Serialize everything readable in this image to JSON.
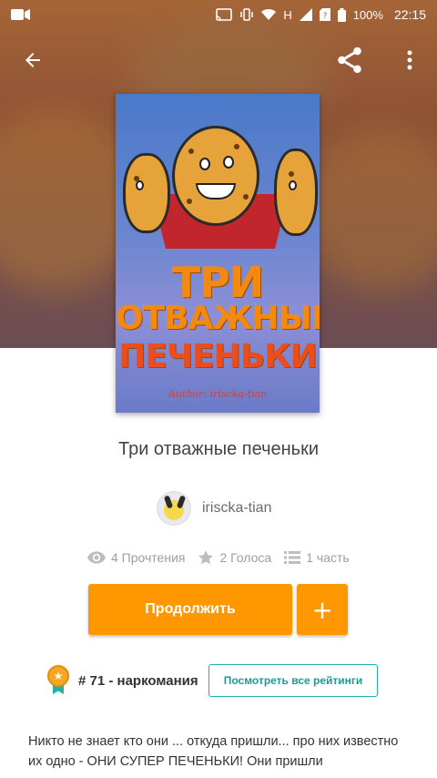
{
  "status_bar": {
    "battery": "100%",
    "time": "22:15",
    "network": "H"
  },
  "toolbar": {
    "back_icon": "arrow-left-icon",
    "share_icon": "share-icon",
    "more_icon": "more-vertical-icon"
  },
  "cover": {
    "title_line1": "ТРИ",
    "title_line2": "ОТВАЖНЫЕ",
    "title_line3": "ПЕЧЕНЬКИ",
    "author_caption": "Author: iriscka-tian"
  },
  "story": {
    "title": "Три отважные печеньки",
    "author": "iriscka-tian",
    "reads": "4 Прочтения",
    "votes": "2 Голоса",
    "parts": "1 часть"
  },
  "actions": {
    "continue_label": "Продолжить",
    "add_label": "+"
  },
  "ranking": {
    "rank_text": "# 71 - наркомания",
    "view_all_label": "Посмотреть все рейтинги"
  },
  "description": {
    "text": "Никто не знает кто они ... откуда пришли... про них известно их одно - ОНИ СУПЕР ПЕЧЕНЬКИ! Они пришли"
  },
  "colors": {
    "accent": "#ff9800",
    "teal": "#1fb2a6"
  }
}
